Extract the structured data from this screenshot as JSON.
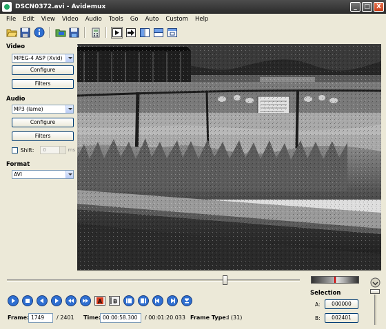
{
  "window": {
    "title": "DSCN0372.avi - Avidemux",
    "minimize": "_",
    "maximize": "□",
    "close": "X"
  },
  "menu": [
    "File",
    "Edit",
    "View",
    "Video",
    "Audio",
    "Tools",
    "Go",
    "Auto",
    "Custom",
    "Help"
  ],
  "toolbar": {
    "icons": [
      "open-folder-icon",
      "save-disk-icon",
      "info-icon",
      "open-video-icon",
      "save-video-icon",
      "calculator-icon",
      "input-display-icon",
      "output-display-icon",
      "side-by-side-icon",
      "top-bottom-icon",
      "separate-window-icon"
    ]
  },
  "video": {
    "section_label": "Video",
    "codec": "MPEG-4 ASP (Xvid)",
    "configure_label": "Configure",
    "filters_label": "Filters"
  },
  "audio": {
    "section_label": "Audio",
    "codec": "MP3 (lame)",
    "configure_label": "Configure",
    "filters_label": "Filters",
    "shift_label": "Shift:",
    "shift_value": "0",
    "shift_unit": "ms",
    "shift_checked": false
  },
  "format": {
    "section_label": "Format",
    "container": "AVI"
  },
  "playback": {
    "position_fraction": 0.745,
    "controls": [
      "play-icon",
      "stop-icon",
      "prev-frame-icon",
      "next-frame-icon",
      "rewind-icon",
      "fast-forward-icon",
      "set-marker-a-icon",
      "set-marker-b-icon",
      "prev-keyframe-icon",
      "next-keyframe-icon",
      "prev-black-frame-icon",
      "next-black-frame-icon",
      "goto-first-icon"
    ],
    "marker_a_glyph": "A",
    "marker_b_glyph": "B"
  },
  "selection": {
    "label": "Selection",
    "a_label": "A:",
    "a_value": "000000",
    "b_label": "B:",
    "b_value": "002401"
  },
  "status": {
    "frame_label": "Frame:",
    "frame_value": "1749",
    "frame_total": "/ 2401",
    "time_label": "Time:",
    "time_value": "00:00:58.300",
    "time_total": "/ 00:01:20.033",
    "frame_type_label": "Frame Type:",
    "frame_type_value": "I (31)"
  },
  "colors": {
    "title_bar": "#3c3c3c",
    "window_bg": "#ece9d8",
    "control_blue": "#2f6fd1",
    "close_red": "#d2502a"
  }
}
